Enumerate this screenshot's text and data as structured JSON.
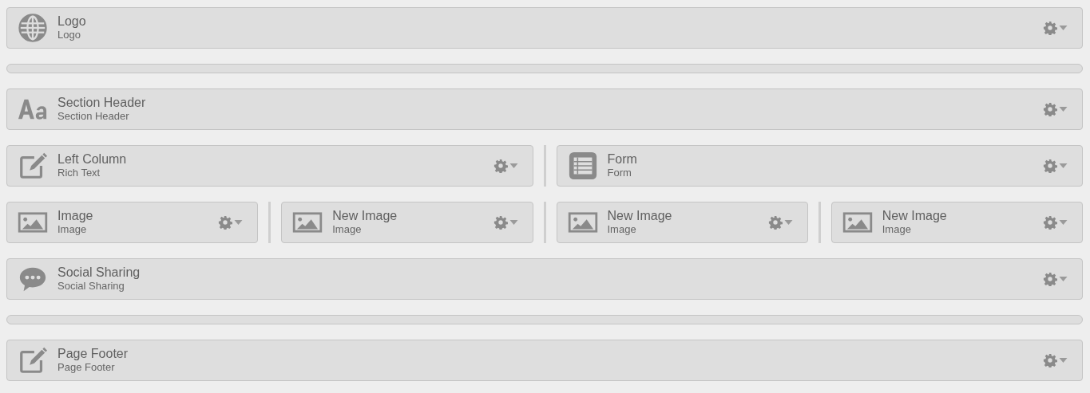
{
  "rows": [
    {
      "kind": "blocks",
      "blocks": [
        {
          "kind": "logo",
          "title": "Logo",
          "subtitle": "Logo"
        }
      ]
    },
    {
      "kind": "empty"
    },
    {
      "kind": "blocks",
      "blocks": [
        {
          "kind": "heading",
          "title": "Section Header",
          "subtitle": "Section Header"
        }
      ]
    },
    {
      "kind": "blocks",
      "blocks": [
        {
          "kind": "richtext",
          "title": "Left Column",
          "subtitle": "Rich Text"
        },
        {
          "kind": "form",
          "title": "Form",
          "subtitle": "Form"
        }
      ]
    },
    {
      "kind": "blocks",
      "blocks": [
        {
          "kind": "image",
          "title": "Image",
          "subtitle": "Image"
        },
        {
          "kind": "image",
          "title": "New Image",
          "subtitle": "Image"
        },
        {
          "kind": "image",
          "title": "New Image",
          "subtitle": "Image"
        },
        {
          "kind": "image",
          "title": "New Image",
          "subtitle": "Image"
        }
      ]
    },
    {
      "kind": "blocks",
      "blocks": [
        {
          "kind": "social",
          "title": "Social Sharing",
          "subtitle": "Social Sharing"
        }
      ]
    },
    {
      "kind": "empty"
    },
    {
      "kind": "blocks",
      "blocks": [
        {
          "kind": "richtext",
          "title": "Page Footer",
          "subtitle": "Page Footer"
        }
      ]
    }
  ]
}
